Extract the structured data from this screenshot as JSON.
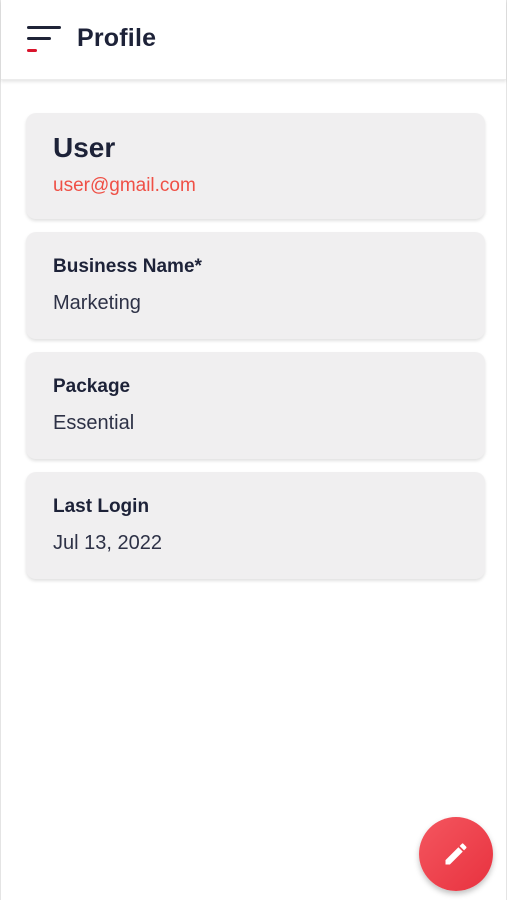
{
  "header": {
    "title": "Profile",
    "menu_icon": "hamburger-menu-icon"
  },
  "user": {
    "name": "User",
    "email": "user@gmail.com"
  },
  "fields": [
    {
      "label": "Business Name*",
      "value": "Marketing"
    },
    {
      "label": "Package",
      "value": "Essential"
    },
    {
      "label": "Last Login",
      "value": "Jul 13, 2022"
    }
  ],
  "fab": {
    "icon": "pencil-icon"
  },
  "colors": {
    "accent": "#ef5046",
    "menu_accent": "#d9142c",
    "card_background": "#f0eff0",
    "text_primary": "#1d2238"
  }
}
